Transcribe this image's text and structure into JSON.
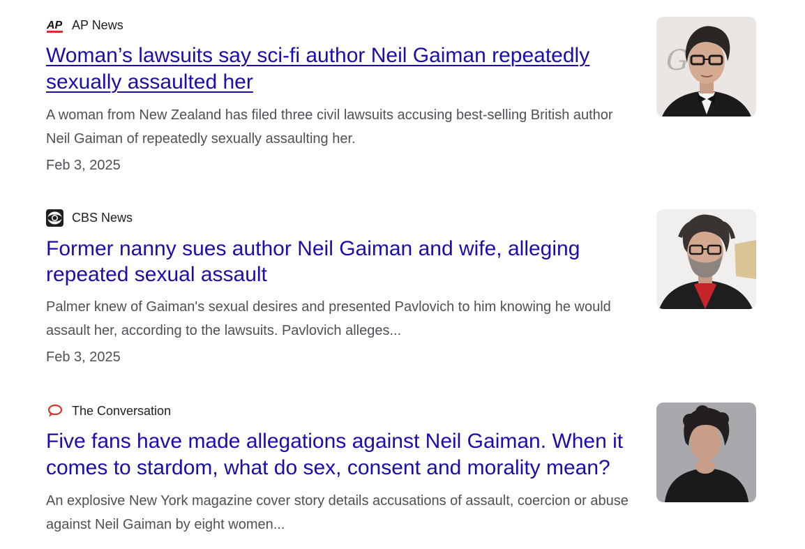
{
  "results": [
    {
      "source": "AP News",
      "source_icon": "ap-news-logo-icon",
      "headline": "Woman’s lawsuits say sci-fi author Neil Gaiman repeatedly sexually assaulted her",
      "snippet": "A woman from New Zealand has filed three civil lawsuits accusing best-selling British author Neil Gaiman of repeatedly sexually assaulting her.",
      "date": "Feb 3, 2025",
      "thumbnail": "portrait-with-glasses-and-bow-tie",
      "visited": true
    },
    {
      "source": "CBS News",
      "source_icon": "cbs-eye-logo-icon",
      "headline": "Former nanny sues author Neil Gaiman and wife, alleging repeated sexual assault",
      "snippet": "Palmer knew of Gaiman's sexual desires and presented Pavlovich to him knowing he would assault her, according to the lawsuits. Pavlovich alleges...",
      "date": "Feb 3, 2025",
      "thumbnail": "portrait-with-glasses-and-red-shirt",
      "visited": false
    },
    {
      "source": "The Conversation",
      "source_icon": "speech-bubble-logo-icon",
      "headline": "Five fans have made allegations against Neil Gaiman. When it comes to stardom, what do sex, consent and morality mean?",
      "snippet": "An explosive New York magazine cover story details accusations of assault, coercion or abuse against Neil Gaiman by eight women...",
      "date": "",
      "thumbnail": "portrait-with-clasped-hands",
      "visited": false
    }
  ],
  "colors": {
    "link": "#1a0dab",
    "snippet": "#4d5156",
    "source": "#202124",
    "ap_red": "#e0282e",
    "conversation_red": "#d8352a"
  },
  "logos": {
    "ap_text": "AP"
  }
}
